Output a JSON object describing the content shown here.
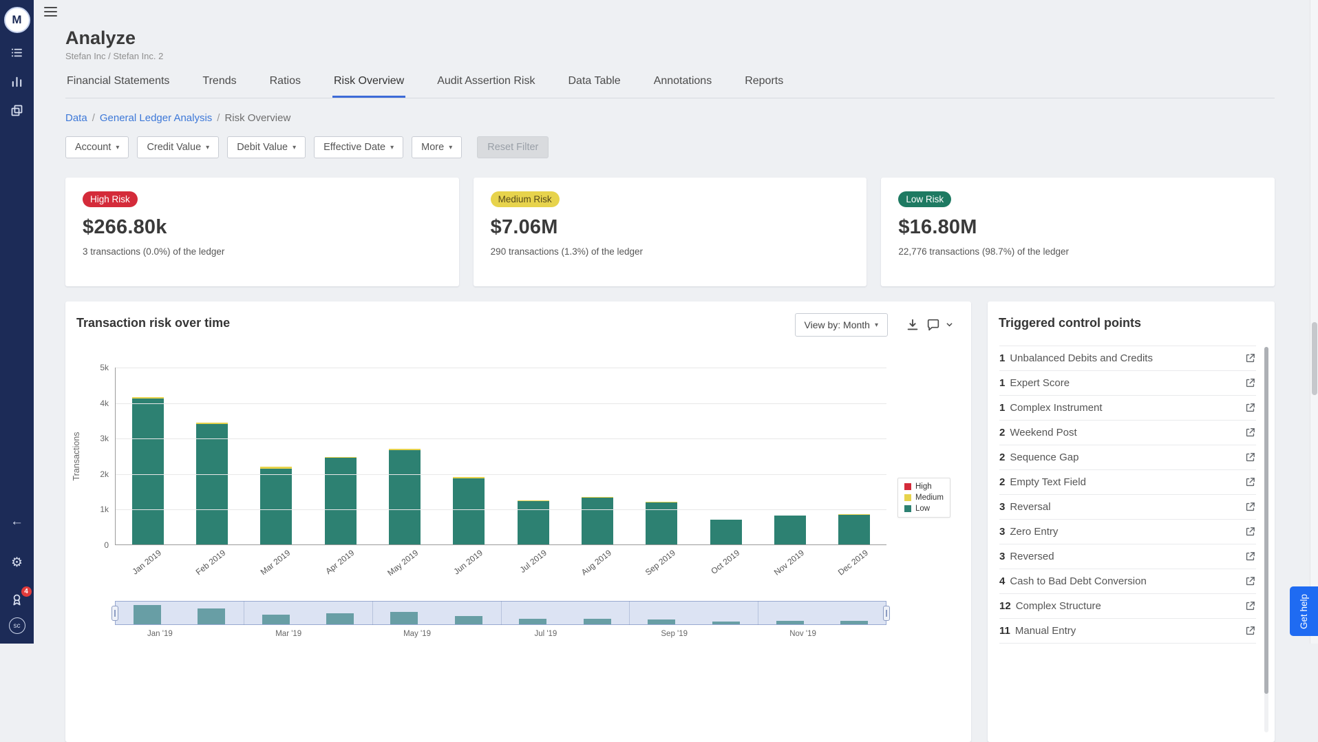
{
  "colors": {
    "sidebar_navy": "#1c2b57",
    "accent_blue": "#3d6bd8",
    "link_blue": "#3d78d8",
    "high_red": "#d42b3a",
    "medium_yellow": "#e7d34c",
    "low_teal": "#2d8172",
    "low_badge_green": "#1e7a62",
    "help_blue": "#1f6bf2"
  },
  "icons": {
    "caret_down": "▾",
    "gear": "⚙",
    "back_arrow": "←"
  },
  "sidebar": {
    "logo_text": "M",
    "avatar_text": "sc",
    "notification_count": "4"
  },
  "header": {
    "title": "Analyze",
    "subtitle": "Stefan Inc / Stefan Inc. 2"
  },
  "tabs": [
    {
      "label": "Financial Statements",
      "active": false
    },
    {
      "label": "Trends",
      "active": false
    },
    {
      "label": "Ratios",
      "active": false
    },
    {
      "label": "Risk Overview",
      "active": true
    },
    {
      "label": "Audit Assertion Risk",
      "active": false
    },
    {
      "label": "Data Table",
      "active": false
    },
    {
      "label": "Annotations",
      "active": false
    },
    {
      "label": "Reports",
      "active": false
    }
  ],
  "breadcrumb": {
    "links": [
      "Data",
      "General Ledger Analysis"
    ],
    "current": "Risk Overview"
  },
  "filters": {
    "dropdowns": [
      "Account",
      "Credit Value",
      "Debit Value",
      "Effective Date",
      "More"
    ],
    "reset_label": "Reset Filter"
  },
  "risk_cards": [
    {
      "badge": "High Risk",
      "badge_color": "#d42b3a",
      "badge_text_color": "#ffffff",
      "amount": "$266.80k",
      "detail": "3 transactions (0.0%) of the ledger"
    },
    {
      "badge": "Medium Risk",
      "badge_color": "#e7d34c",
      "badge_text_color": "#55491a",
      "amount": "$7.06M",
      "detail": "290 transactions (1.3%) of the ledger"
    },
    {
      "badge": "Low Risk",
      "badge_color": "#1e7a62",
      "badge_text_color": "#ffffff",
      "amount": "$16.80M",
      "detail": "22,776 transactions (98.7%) of the ledger"
    }
  ],
  "chart_card": {
    "title": "Transaction risk over time",
    "view_by_label": "View by: Month"
  },
  "chart_data": {
    "type": "bar",
    "stacked": true,
    "title": "Transaction risk over time",
    "xlabel": "",
    "ylabel": "Transactions",
    "ylim": [
      0,
      5000
    ],
    "yticks": [
      "0",
      "1k",
      "2k",
      "3k",
      "4k",
      "5k"
    ],
    "grid": "horizontal",
    "legend_position": "right",
    "categories": [
      "Jan 2019",
      "Feb 2019",
      "Mar 2019",
      "Apr 2019",
      "May 2019",
      "Jun 2019",
      "Jul 2019",
      "Aug 2019",
      "Sep 2019",
      "Oct 2019",
      "Nov 2019",
      "Dec 2019"
    ],
    "series": [
      {
        "name": "Low",
        "color": "#2d8172",
        "values": [
          4100,
          3400,
          2140,
          2440,
          2650,
          1870,
          1220,
          1320,
          1180,
          700,
          820,
          840
        ]
      },
      {
        "name": "Medium",
        "color": "#e7d34c",
        "values": [
          40,
          40,
          45,
          25,
          45,
          20,
          15,
          15,
          15,
          8,
          10,
          12
        ]
      },
      {
        "name": "High",
        "color": "#d42b3a",
        "values": [
          1,
          0,
          0,
          0,
          1,
          0,
          0,
          0,
          0,
          0,
          1,
          0
        ]
      }
    ],
    "legend": [
      "High",
      "Medium",
      "Low"
    ],
    "navigator_labels": [
      "Jan '19",
      "Mar '19",
      "May '19",
      "Jul '19",
      "Sep '19",
      "Nov '19"
    ]
  },
  "control_points": {
    "title": "Triggered control points",
    "items": [
      {
        "count": "1",
        "label": "Unbalanced Debits and Credits"
      },
      {
        "count": "1",
        "label": "Expert Score"
      },
      {
        "count": "1",
        "label": "Complex Instrument"
      },
      {
        "count": "2",
        "label": "Weekend Post"
      },
      {
        "count": "2",
        "label": "Sequence Gap"
      },
      {
        "count": "2",
        "label": "Empty Text Field"
      },
      {
        "count": "3",
        "label": "Reversal"
      },
      {
        "count": "3",
        "label": "Zero Entry"
      },
      {
        "count": "3",
        "label": "Reversed"
      },
      {
        "count": "4",
        "label": "Cash to Bad Debt Conversion"
      },
      {
        "count": "12",
        "label": "Complex Structure"
      },
      {
        "count": "11",
        "label": "Manual Entry"
      }
    ]
  },
  "help_tab": {
    "label": "Get help"
  }
}
